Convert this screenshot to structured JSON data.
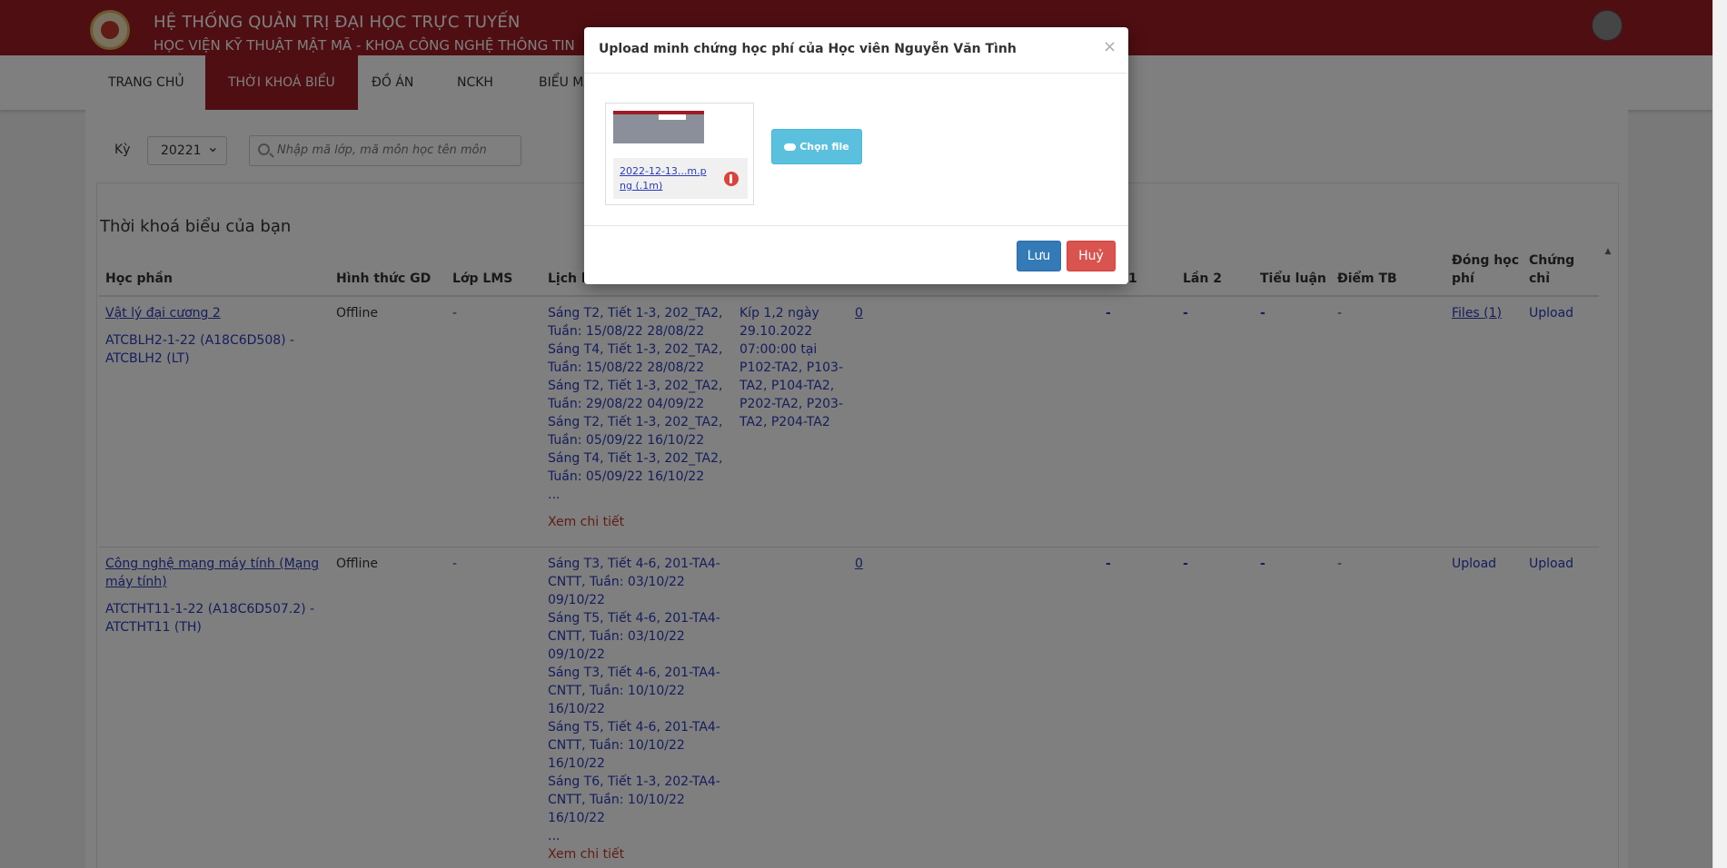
{
  "header": {
    "title": "HỆ THỐNG QUẢN TRỊ ĐẠI HỌC TRỰC TUYẾN",
    "subtitle": "HỌC VIỆN KỸ THUẬT MẬT MÃ - KHOA CÔNG NGHỆ THÔNG TIN"
  },
  "nav": {
    "home": "TRANG CHỦ",
    "timetable": "THỜI KHOÁ BIỂU",
    "project": "ĐỒ ÁN",
    "research": "NCKH",
    "forms": "BIỂU MẪ"
  },
  "filter": {
    "term_label": "Kỳ",
    "term_value": "20221",
    "search_placeholder": "Nhập mã lớp, mã môn học tên môn"
  },
  "section_title": "Thời khoá biểu của bạn",
  "table": {
    "headers": {
      "course": "Học phần",
      "mode": "Hình thức GD",
      "lms": "Lớp LMS",
      "schedule": "Lịch h",
      "round1": "1",
      "round2": "Lần 2",
      "essay": "Tiểu luận",
      "gpa": "Điểm TB",
      "fee_line1": "Đóng học",
      "fee_line2": "phí",
      "cert_line1": "Chứng",
      "cert_line2": "chỉ"
    },
    "rows": [
      {
        "course_name": "Vật lý đại cương 2",
        "course_code_1": "ATCBLH2-1-22 (A18C6D508) -",
        "course_code_2": "ATCBLH2 (LT)",
        "mode": "Offline",
        "lms": "-",
        "schedule": [
          "Sáng T2, Tiết 1-3, 202_TA2,",
          "Tuần: 15/08/22 28/08/22",
          "Sáng T4, Tiết 1-3, 202_TA2,",
          "Tuần: 15/08/22 28/08/22",
          "Sáng T2, Tiết 1-3, 202_TA2,",
          "Tuần: 29/08/22 04/09/22",
          "Sáng T2, Tiết 1-3, 202_TA2,",
          "Tuần: 05/09/22 16/10/22",
          "Sáng T4, Tiết 1-3, 202_TA2,",
          "Tuần: 05/09/22 16/10/22",
          "..."
        ],
        "detail_link": "Xem chi tiết",
        "exam": [
          "Kíp 1,2 ngày",
          "29.10.2022",
          "07:00:00 tại",
          "P102-TA2, P103-",
          "TA2, P104-TA2,",
          "P202-TA2, P203-",
          "TA2, P204-TA2"
        ],
        "count": "0",
        "round1": "-",
        "round2": "-",
        "essay": "-",
        "gpa": "-",
        "fee": "Files (1)",
        "cert": "Upload"
      },
      {
        "course_name_1": "Công nghệ mạng máy tính (Mạng",
        "course_name_2": "máy tính)",
        "course_code_1": "ATCTHT11-1-22 (A18C6D507.2) -",
        "course_code_2": "ATCTHT11 (TH)",
        "mode": "Offline",
        "lms": "-",
        "schedule": [
          "Sáng T3, Tiết 4-6, 201-TA4-",
          "CNTT, Tuần: 03/10/22",
          "09/10/22",
          "Sáng T5, Tiết 4-6, 201-TA4-",
          "CNTT, Tuần: 03/10/22",
          "09/10/22",
          "Sáng T3, Tiết 4-6, 201-TA4-",
          "CNTT, Tuần: 10/10/22",
          "16/10/22",
          "Sáng T5, Tiết 4-6, 201-TA4-",
          "CNTT, Tuần: 10/10/22",
          "16/10/22",
          "Sáng T6, Tiết 1-3, 202-TA4-",
          "CNTT, Tuần: 10/10/22",
          "16/10/22",
          "..."
        ],
        "detail_link": "Xem chi tiết",
        "count": "0",
        "round1": "-",
        "round2": "-",
        "essay": "-",
        "gpa": "-",
        "fee": "Upload",
        "cert": "Upload"
      }
    ]
  },
  "modal": {
    "title": "Upload minh chứng học phí của Học viên Nguyễn Văn Tình",
    "close": "×",
    "file_name": "2022-12-13...m.png (.1m)",
    "choose_label": "Chọn file",
    "save_label": "Lưu",
    "cancel_label": "Huỷ"
  }
}
